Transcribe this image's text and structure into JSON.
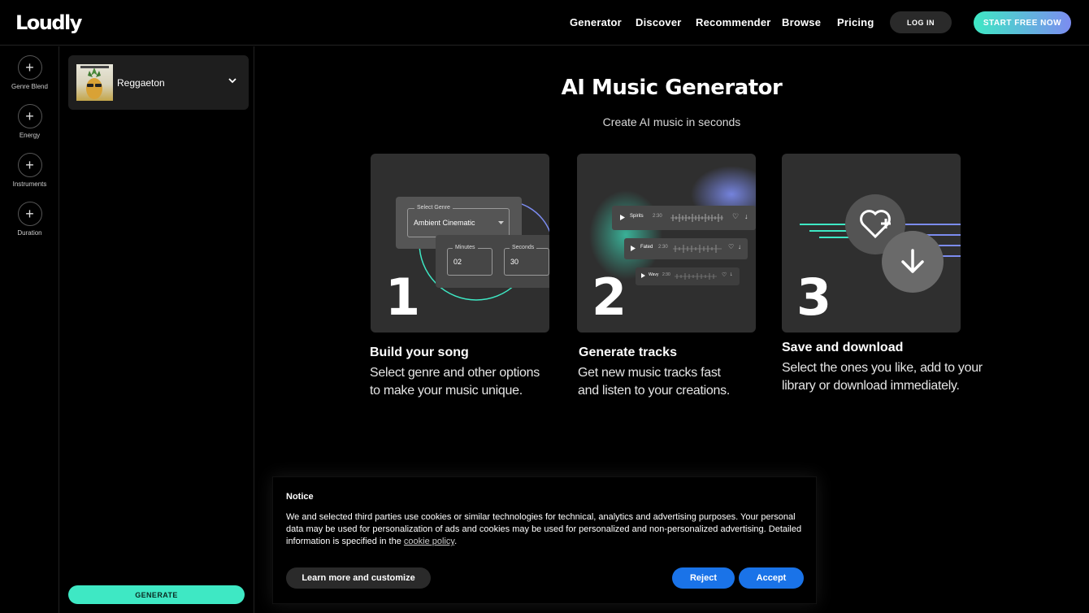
{
  "header": {
    "logo": "Loudly",
    "nav": [
      "Generator",
      "Discover",
      "Recommender",
      "Browse",
      "Pricing"
    ],
    "login_label": "LOG IN",
    "start_label": "START FREE NOW"
  },
  "rail": {
    "items": [
      "Genre Blend",
      "Energy",
      "Instruments",
      "Duration"
    ]
  },
  "panel": {
    "genre": "Reggaeton",
    "generate_label": "GENERATE"
  },
  "hero": {
    "title": "AI Music Generator",
    "subtitle": "Create AI music in seconds"
  },
  "steps": [
    {
      "number": "1",
      "title": "Build your song",
      "desc_line1": "Select genre and other options",
      "desc_line2": "to make your music unique.",
      "select_label": "Select Genre",
      "select_value": "Ambient Cinematic",
      "minutes_label": "Minutes",
      "minutes_value": "02",
      "seconds_label": "Seconds",
      "seconds_value": "30"
    },
    {
      "number": "2",
      "title": "Generate tracks",
      "desc_line1": "Get new music tracks fast",
      "desc_line2": "and listen to your creations.",
      "tracks": [
        "Spirits",
        "Fated",
        "Wavy"
      ],
      "track_times": [
        "2:30",
        "2:30",
        "2:30"
      ]
    },
    {
      "number": "3",
      "title": "Save and download",
      "desc_line1": "Select the ones you like, add to your",
      "desc_line2": "library or download immediately."
    }
  ],
  "cookie": {
    "title": "Notice",
    "text": "We and selected third parties use cookies or similar technologies for technical, analytics and advertising purposes. Your personal data may be used for personalization of ads and cookies may be used for personalized and non-personalized advertising. Detailed information is specified in the",
    "link_text": "cookie policy",
    "link_suffix": ".",
    "learn_label": "Learn more and customize",
    "reject_label": "Reject",
    "accept_label": "Accept"
  },
  "colors": {
    "accent_teal": "#3ee8c4",
    "accent_violet": "#7c8cf0",
    "button_blue": "#1a73e8"
  }
}
